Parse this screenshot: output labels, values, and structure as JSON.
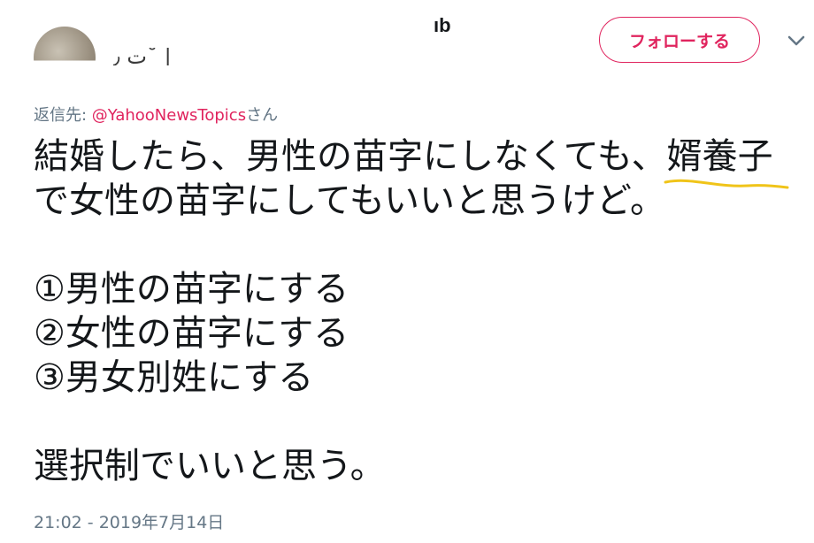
{
  "header": {
    "handle_fragment": "ıb",
    "name_fragment": "ت ٫˘ |_",
    "follow_button": "フォローする",
    "accent_color": "#e0245e",
    "menu_icon": "chevron-down-icon",
    "avatar_icon": "avatar"
  },
  "tweet": {
    "reply_prefix": "返信先: ",
    "reply_mention": "@YahooNewsTopics",
    "reply_suffix": "さん",
    "lines": [
      "結婚したら、男性の苗字にしなくても、",
      "婿養子",
      "で女性の苗字にしてもいいと思うけど。",
      "①男性の苗字にする",
      "②女性の苗字にする",
      "③男女別姓にする",
      "選択制でいいと思う。"
    ],
    "highlight_color": "#f0c419",
    "timestamp": "21:02 - 2019年7月14日"
  }
}
